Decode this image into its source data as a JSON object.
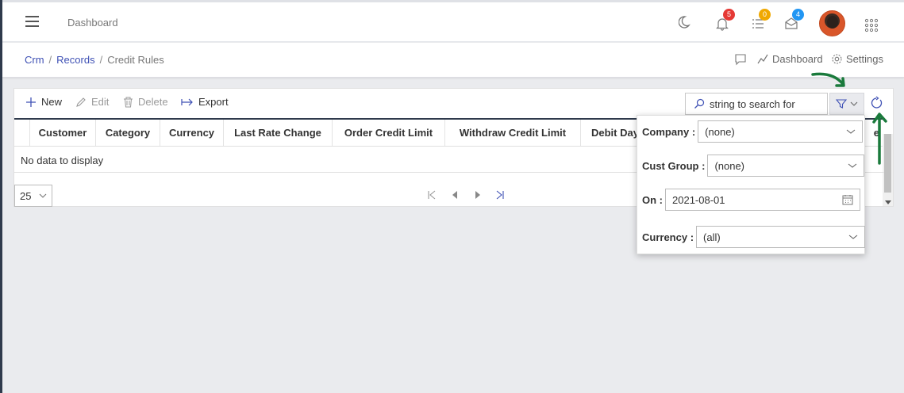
{
  "topbar": {
    "title": "Dashboard",
    "notifications": {
      "count": "5",
      "color": "#e53935"
    },
    "tasks": {
      "count": "0",
      "color": "#f0a800"
    },
    "messages": {
      "count": "4",
      "color": "#2196f3"
    }
  },
  "breadcrumb": {
    "items": [
      "Crm",
      "Records",
      "Credit Rules"
    ],
    "dashboard_link": "Dashboard",
    "settings_link": "Settings"
  },
  "toolbar": {
    "new_label": "New",
    "edit_label": "Edit",
    "delete_label": "Delete",
    "export_label": "Export",
    "search_placeholder": "string to search for"
  },
  "grid": {
    "columns": [
      "Customer",
      "Category",
      "Currency",
      "Last Rate Change",
      "Order Credit Limit",
      "Withdraw Credit Limit",
      "Debit Day",
      "e"
    ],
    "empty_text": "No data to display"
  },
  "pager": {
    "page_size": "25"
  },
  "filters": {
    "company": {
      "label": "Company :",
      "value": "(none)"
    },
    "cust_group": {
      "label": "Cust Group :",
      "value": "(none)"
    },
    "on": {
      "label": "On :",
      "value": "2021-08-01"
    },
    "currency": {
      "label": "Currency :",
      "value": "(all)"
    }
  },
  "colors": {
    "accent": "#3f51b5",
    "sidebar": "#2f3a4c",
    "annotation": "#1a7a3c"
  }
}
